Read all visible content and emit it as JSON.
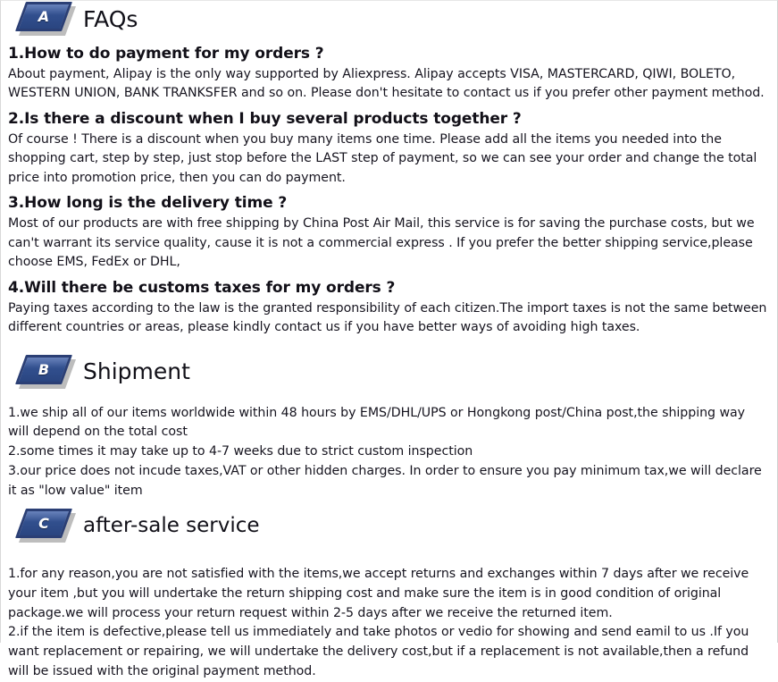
{
  "sections": [
    {
      "badge_letter": "A",
      "title": "FAQs",
      "faqs": [
        {
          "question": "1.How to do payment for my orders ?",
          "answer": "About payment, Alipay is the only way supported by Aliexpress. Alipay accepts VISA, MASTERCARD, QIWI, BOLETO, WESTERN UNION, BANK TRANKSFER and so on. Please don't hesitate to contact us if you prefer other payment method."
        },
        {
          "question": "2.Is there a discount when I buy several products together ?",
          "answer": "Of course ! There is a discount when you buy many items one time. Please add all the items you needed into the shopping cart, step by step, just stop before the LAST step of payment, so we can see your order and change the total price into promotion price, then you can do payment."
        },
        {
          "question": "3.How long is the delivery time ?",
          "answer": "Most of our products are with free shipping by China Post Air Mail, this service is for saving the purchase costs, but we can't warrant its service quality, cause it is not a commercial express . If you prefer the better shipping service,please choose EMS, FedEx or DHL,"
        },
        {
          "question": "4.Will there be customs taxes for my orders ?",
          "answer": "Paying taxes according to the law is the granted responsibility of each citizen.The import taxes is not the same between different countries or areas, please kindly contact us if you have better ways of avoiding high taxes."
        }
      ]
    },
    {
      "badge_letter": "B",
      "title": "Shipment",
      "lines": [
        "1.we ship all of our items worldwide within 48 hours by EMS/DHL/UPS or Hongkong post/China post,the shipping way will depend on the total cost",
        "2.some times it may take up to 4-7 weeks due to strict custom inspection",
        "3.our price does not incude taxes,VAT or other hidden charges. In order to ensure you pay minimum tax,we will declare it as \"low value\" item"
      ]
    },
    {
      "badge_letter": "C",
      "title": "after-sale service",
      "lines": [
        "1.for any reason,you are not satisfied with the items,we accept returns and exchanges within 7 days after we receive your item ,but you will undertake the return shipping cost and make sure the item is in good condition of original package.we will process your return request within 2-5 days after we receive the returned item.",
        "2.if the item is defective,please tell us immediately and take photos or vedio for showing and send eamil to us .If you want replacement or repairing, we will undertake the delivery cost,but if a replacement is not available,then a refund will be issued with the original payment method."
      ]
    }
  ],
  "colors": {
    "badge_fill": "#32508f",
    "badge_border": "#2b3f75",
    "text": "#16141f",
    "heading": "#111018",
    "page_bg": "#ffffff"
  }
}
